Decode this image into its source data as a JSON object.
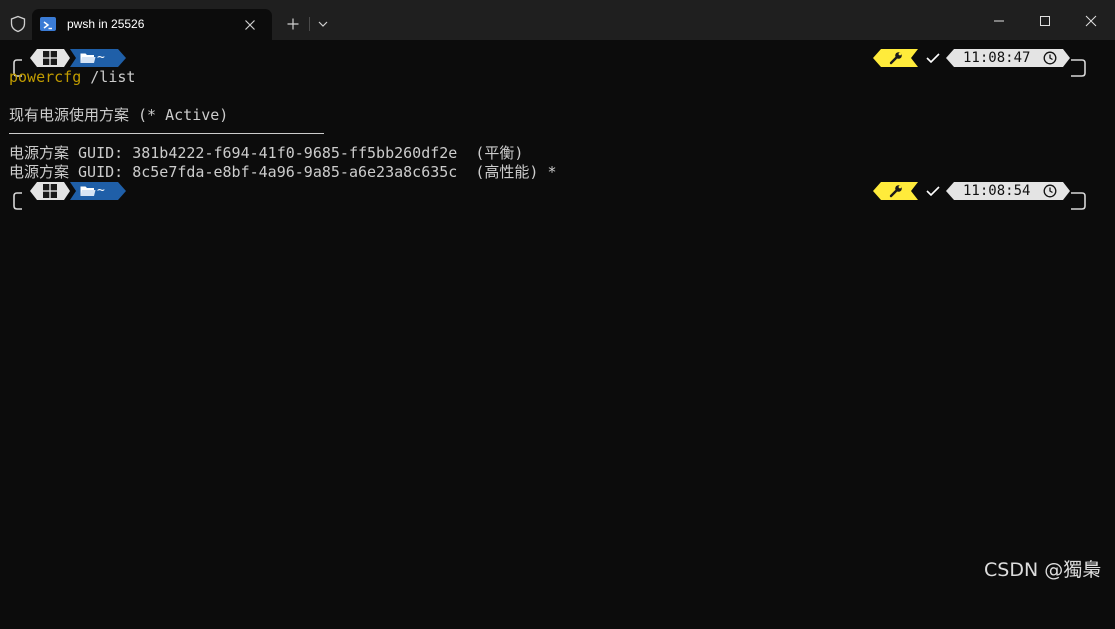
{
  "window": {
    "tab_title": "pwsh in 25526"
  },
  "prompts": [
    {
      "path": "~",
      "time": "11:08:47"
    },
    {
      "path": "~",
      "time": "11:08:54"
    }
  ],
  "terminal": {
    "command_name": "powercfg",
    "command_args": " /list",
    "output_header": "现有电源使用方案 (* Active)",
    "schemes": [
      "电源方案 GUID: 381b4222-f694-41f0-9685-ff5bb260df2e  (平衡)",
      "电源方案 GUID: 8c5e7fda-e8bf-4a96-9a85-a6e23a8c635c  (高性能) *"
    ]
  },
  "watermark": "CSDN @獨梟",
  "colors": {
    "background": "#0c0c0c",
    "titlebar": "#1f1f1f",
    "command": "#c19c00",
    "path_segment": "#1f5fa8",
    "tool_segment": "#ffeb3b",
    "time_segment": "#e4e4e4"
  },
  "icons": [
    "shield-icon",
    "powershell-icon",
    "close-icon",
    "plus-icon",
    "chevron-down-icon",
    "minimize-icon",
    "maximize-icon",
    "windows-icon",
    "folder-icon",
    "wrench-icon",
    "check-icon",
    "clock-icon"
  ]
}
